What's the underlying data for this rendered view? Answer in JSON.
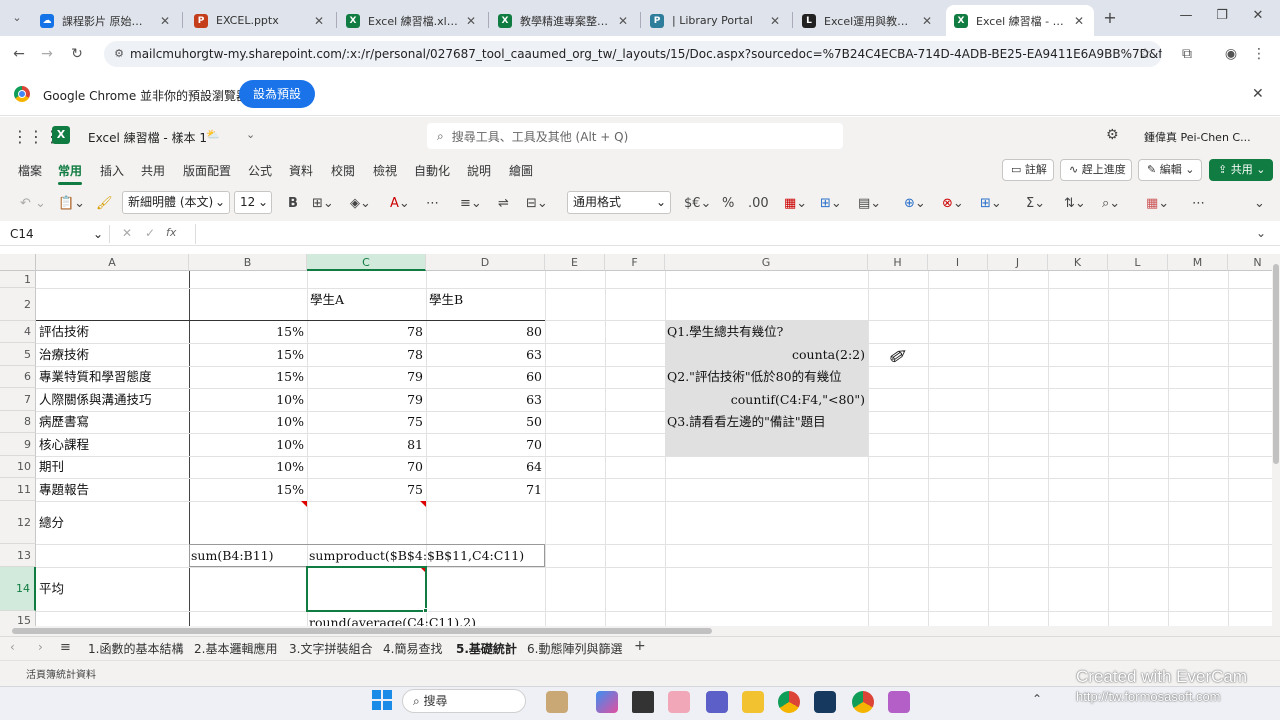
{
  "browser": {
    "tabs": [
      {
        "label": "課程影片 原始檔與素",
        "icon": "cloud-icon",
        "color": "#1473e6"
      },
      {
        "label": "EXCEL.pptx",
        "icon": "powerpoint-icon",
        "color": "#c43e1c"
      },
      {
        "label": "Excel 練習檔.xlsx",
        "icon": "excel-icon",
        "color": "#107c41"
      },
      {
        "label": "教學精進專案整理.xl",
        "icon": "excel-icon",
        "color": "#107c41"
      },
      {
        "label": "| Library Portal",
        "icon": "portal-icon",
        "color": "#2e7d9a"
      },
      {
        "label": "Excel運用與教學習",
        "icon": "l-icon",
        "color": "#222222"
      },
      {
        "label": "Excel 練習檔 - 樣本",
        "icon": "excel-icon",
        "color": "#107c41",
        "active": true
      }
    ],
    "url": "mailcmuhorgtw-my.sharepoint.com/:x:/r/personal/027687_tool_caaumed_org_tw/_layouts/15/Doc.aspx?sourcedoc=%7B24C4ECBA-714D-4ADB-BE25-EA9411E6A9BB%7D&file=Ex...",
    "infobar_text": "Google Chrome 並非你的預設瀏覽器",
    "infobar_button": "設為預設"
  },
  "excel": {
    "file_title": "Excel 練習檔 - 樣本 1",
    "search_placeholder": "搜尋工具、工具及其他 (Alt + Q)",
    "user": "鍾偉真 Pei-Chen C...",
    "menus": [
      "檔案",
      "常用",
      "插入",
      "共用",
      "版面配置",
      "公式",
      "資料",
      "校閱",
      "檢視",
      "自動化",
      "說明",
      "繪圖"
    ],
    "active_menu": "常用",
    "ribbon_buttons": {
      "comments": "註解",
      "catchup": "趕上進度",
      "editing": "編輯",
      "share": "共用"
    },
    "font_name": "新細明體 (本文)",
    "font_size": "12",
    "number_format": "通用格式",
    "cell_ref": "C14",
    "formula_fx": "fx",
    "columns": [
      "A",
      "B",
      "C",
      "D",
      "E",
      "F",
      "G",
      "H",
      "I",
      "J",
      "K",
      "L",
      "M",
      "N"
    ],
    "selected_column": "C",
    "rows": [
      "1",
      "2",
      "4",
      "5",
      "6",
      "7",
      "8",
      "9",
      "10",
      "11",
      "12",
      "13",
      "14",
      "15"
    ],
    "selected_row": "14",
    "header_b": "學生A",
    "header_c": "學生B",
    "items": [
      {
        "name": "評估技術",
        "weight": "15%",
        "a": "78",
        "b": "80"
      },
      {
        "name": "治療技術",
        "weight": "15%",
        "a": "78",
        "b": "63"
      },
      {
        "name": "專業特質和學習態度",
        "weight": "15%",
        "a": "79",
        "b": "60"
      },
      {
        "name": "人際關係與溝通技巧",
        "weight": "10%",
        "a": "79",
        "b": "63"
      },
      {
        "name": "病歷書寫",
        "weight": "10%",
        "a": "75",
        "b": "50"
      },
      {
        "name": "核心課程",
        "weight": "10%",
        "a": "81",
        "b": "70"
      },
      {
        "name": "期刊",
        "weight": "10%",
        "a": "70",
        "b": "64"
      },
      {
        "name": "專題報告",
        "weight": "15%",
        "a": "75",
        "b": "71"
      }
    ],
    "total_label": "總分",
    "sum_formula": "sum(B4:B11)",
    "sumproduct_formula": "sumproduct($B$4:$B$11,C4:C11)",
    "avg_label": "平均",
    "round_formula": "round(average(C4:C11),2)",
    "questions": {
      "q1": "Q1.學生總共有幾位?",
      "q1_ans": "counta(2:2)",
      "q2": "Q2.\"評估技術\"低於80的有幾位",
      "q2_ans": "countif(C4:F4,\"<80\")",
      "q3": "Q3.請看看左邊的\"備註\"題目"
    },
    "sheets": [
      "1.函數的基本結構",
      "2.基本邏輯應用",
      "3.文字拼裝組合",
      "4.簡易查找",
      "5.基礎統計",
      "6.動態陣列與篩選"
    ],
    "active_sheet": "5.基礎統計",
    "status_text": "活頁簿統計資料"
  },
  "taskbar": {
    "search_label": "搜尋"
  },
  "watermark": {
    "line1": "Created with EverCam",
    "line2": "http://tw.formosasoft.com"
  },
  "colors": {
    "excel_green": "#107c41",
    "chrome_blue": "#1a73e8",
    "question_bg": "#e0e0e0"
  }
}
